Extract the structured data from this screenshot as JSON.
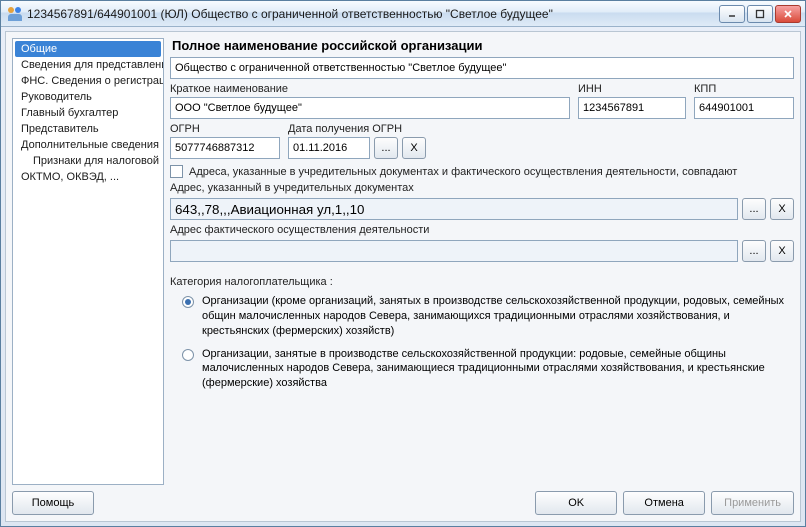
{
  "title": "1234567891/644901001 (ЮЛ) Общество с ограниченной ответственностью \"Светлое будущее\"",
  "sidebar": {
    "items": [
      {
        "label": "Общие",
        "selected": true
      },
      {
        "label": "Сведения для представлени"
      },
      {
        "label": "ФНС. Сведения о регистрац"
      },
      {
        "label": "Руководитель"
      },
      {
        "label": "Главный бухгалтер"
      },
      {
        "label": "Представитель"
      },
      {
        "label": "Дополнительные сведения"
      },
      {
        "label": "Признаки для налоговой",
        "indent": true
      },
      {
        "label": "ОКТМО, ОКВЭД, ..."
      }
    ]
  },
  "main": {
    "section_title": "Полное наименование российской организации",
    "full_name": "Общество с ограниченной ответственностью \"Светлое будущее\"",
    "short_name_label": "Краткое наименование",
    "short_name": "ООО \"Светлое будущее\"",
    "inn_label": "ИНН",
    "inn": "1234567891",
    "kpp_label": "КПП",
    "kpp": "644901001",
    "ogrn_label": "ОГРН",
    "ogrn": "5077746887312",
    "ogrn_date_label": "Дата получения ОГРН",
    "ogrn_date": "01.11.2016",
    "ogrn_date_browse": "...",
    "ogrn_date_clear": "X",
    "addresses_match_checkbox": "Адреса, указанные в учредительных документах и фактического осуществления деятельности, совпадают",
    "addr_legal_label": "Адрес, указанный в учредительных документах",
    "addr_legal_value": "643,,78,,,Авиационная ул,1,,10",
    "addr_actual_label": "Адрес фактического осуществления деятельности",
    "addr_actual_value": "",
    "addr_browse": "...",
    "addr_clear": "X",
    "taxpayer_category_label": "Категория налогоплательщика :",
    "taxpayer_options": [
      "Организации (кроме организаций, занятых в производстве сельскохозяйственной продукции, родовых, семейных общин малочисленных народов Севера, занимающихся традиционными отраслями хозяйствования, и крестьянских (фермерских) хозяйств)",
      "Организации, занятые в производстве сельскохозяйственной продукции: родовые, семейные общины малочисленных народов Севера, занимающиеся традиционными отраслями хозяйствования, и крестьянские (фермерские) хозяйства"
    ]
  },
  "footer": {
    "help": "Помощь",
    "ok": "OK",
    "cancel": "Отмена",
    "apply": "Применить"
  }
}
